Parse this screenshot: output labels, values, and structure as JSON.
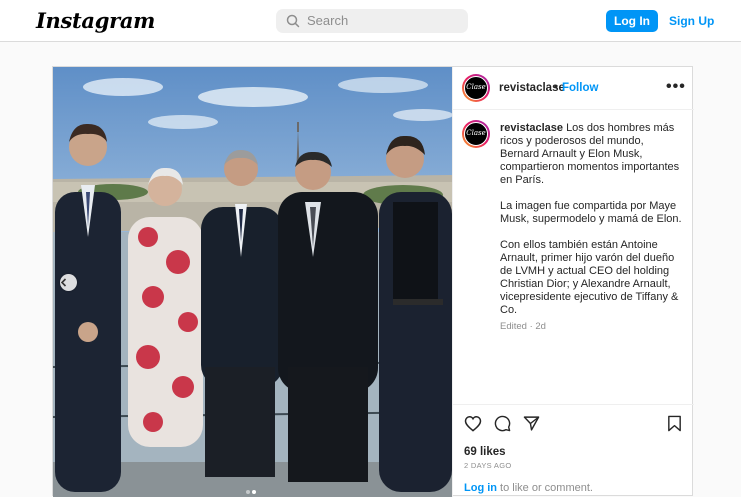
{
  "topbar": {
    "logo": "Instagram",
    "search_placeholder": "Search",
    "login_label": "Log In",
    "signup_label": "Sign Up"
  },
  "post": {
    "username": "revistaclase",
    "avatar_text": "Clase",
    "separator": "•",
    "follow_label": "Follow",
    "more_label": "•••",
    "caption": {
      "username": "revistaclase",
      "paragraphs": [
        "Los dos hombres más ricos y poderosos del mundo, Bernard Arnault y Elon Musk, compartieron momentos importantes en París.",
        "La imagen fue compartida por Maye Musk, supermodelo y mamá de Elon.",
        "Con ellos también están Antoine Arnault, primer hijo varón del dueño de LVMH y actual CEO del holding Christian Dior; y Alexandre Arnault, vicepresidente ejecutivo de Tiffany & Co."
      ]
    },
    "edited": "Edited · 2d",
    "likes": "69 likes",
    "time_ago": "2 DAYS AGO",
    "login_prompt": {
      "link": "Log in",
      "text": " to like or comment."
    },
    "carousel": {
      "prev_icon": "chevron-left-icon",
      "slide_count": 2,
      "active_index": 1
    }
  },
  "colors": {
    "accent": "#0095f6",
    "border": "#dbdbdb",
    "muted": "#8e8e8e"
  }
}
